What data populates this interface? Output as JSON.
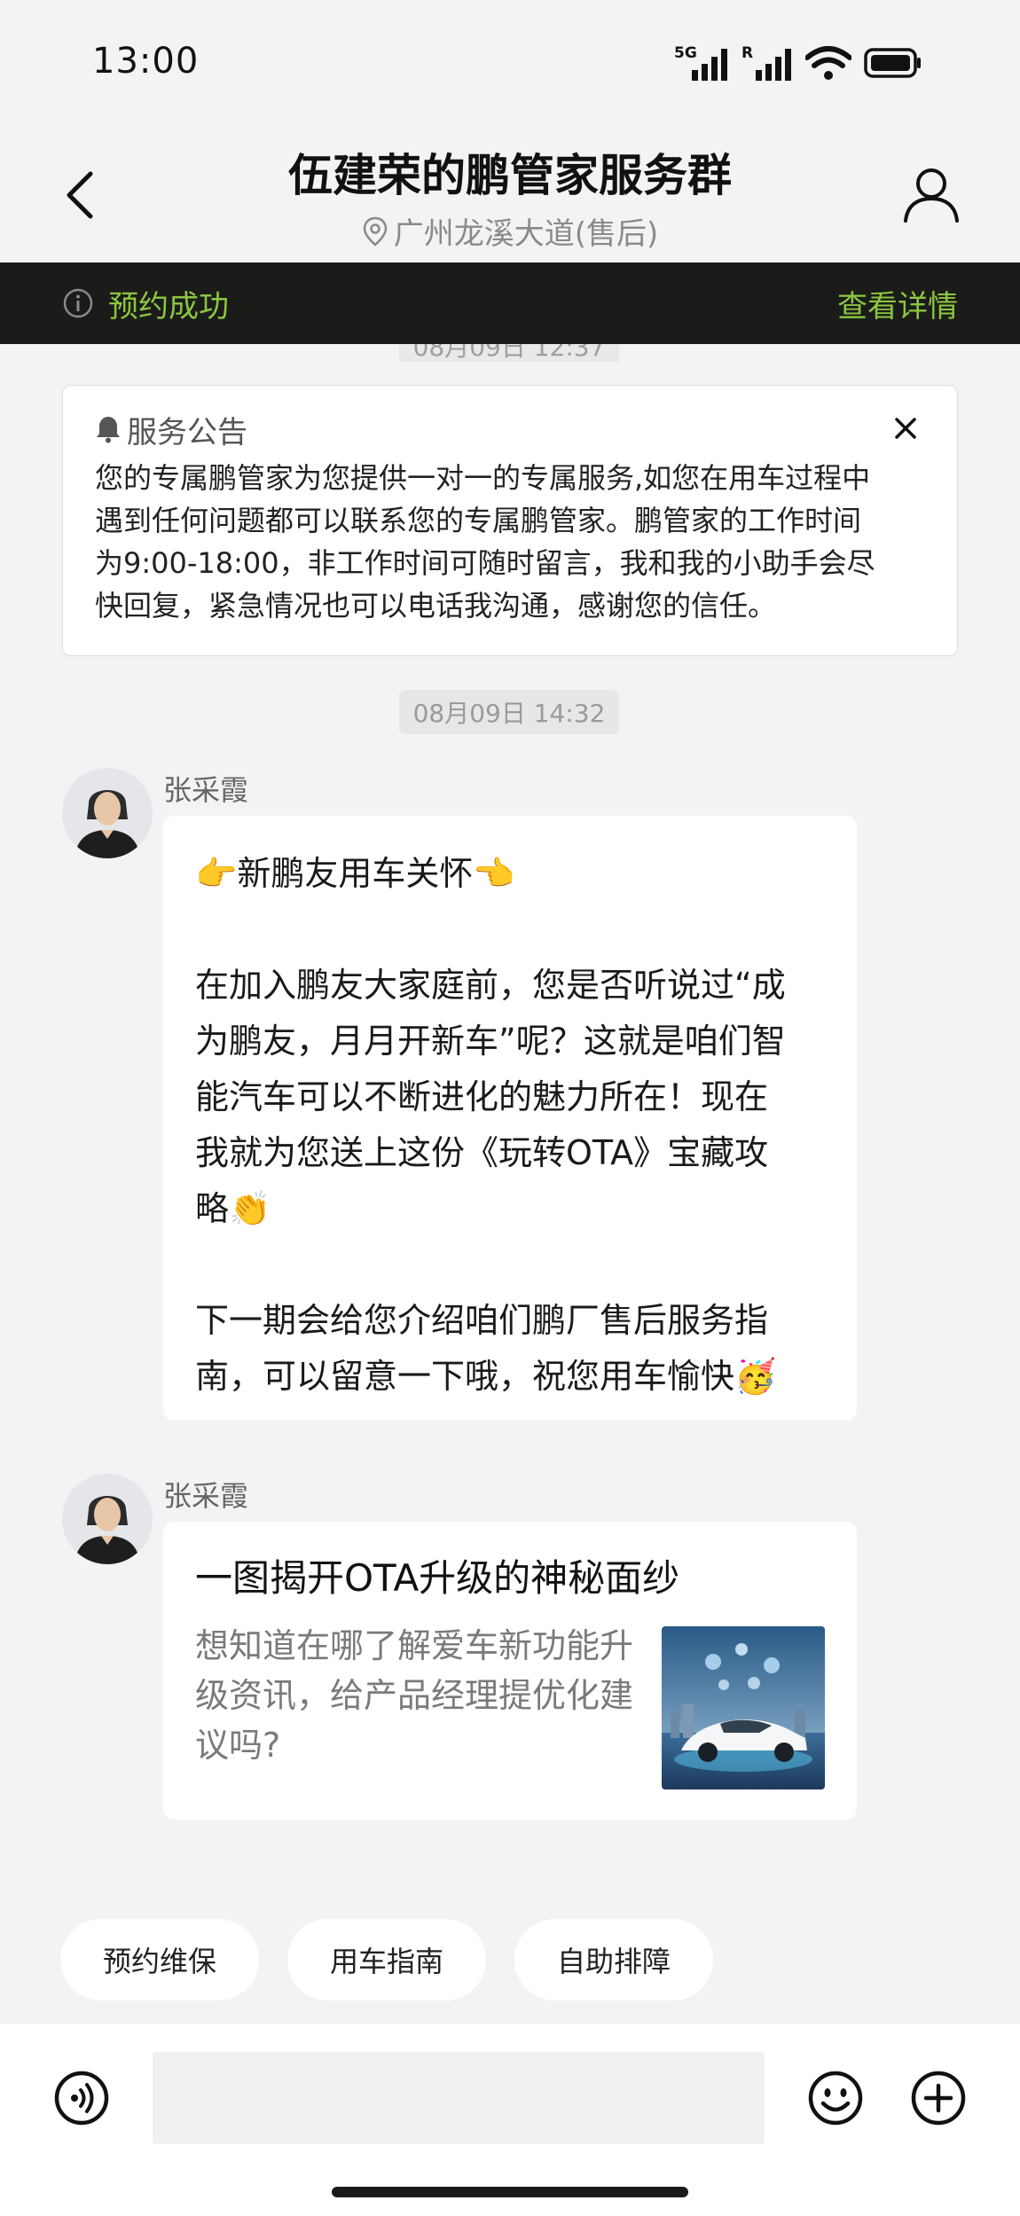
{
  "status_bar": {
    "time": "13:00",
    "signal1_label": "5G",
    "signal2_label": "R"
  },
  "header": {
    "title": "伍建荣的鹏管家服务群",
    "location": "广州龙溪大道(售后)"
  },
  "banner": {
    "status": "预约成功",
    "link": "查看详情"
  },
  "partial_timestamp": "08月09日 12:37",
  "announcement": {
    "title": "服务公告",
    "lines": [
      "您的专属鹏管家为您提供一对一的专属服务,如您在用车过程中",
      "遇到任何问题都可以联系您的专属鹏管家。鹏管家的工作时间",
      "为9:00-18:00，非工作时间可随时留言，我和我的小助手会尽",
      "快回复，紧急情况也可以电话我沟通，感谢您的信任。"
    ]
  },
  "timestamp": "08月09日 14:32",
  "messages": [
    {
      "sender": "张采霞",
      "lines": [
        "👉新鹏友用车关怀👈",
        "",
        "在加入鹏友大家庭前，您是否听说过“成",
        "为鹏友，月月开新车”呢？这就是咱们智",
        "能汽车可以不断进化的魅力所在！现在",
        "我就为您送上这份《玩转OTA》宝藏攻",
        "略👏",
        "",
        "下一期会给您介绍咱们鹏厂售后服务指",
        "南，可以留意一下哦，祝您用车愉快🥳"
      ]
    },
    {
      "sender": "张采霞",
      "card": {
        "title": "一图揭开OTA升级的神秘面纱",
        "description": "想知道在哪了解爱车新功能升级资讯，给产品经理提优化建议吗?"
      }
    }
  ],
  "quick_actions": [
    "预约维保",
    "用车指南",
    "自助排障"
  ],
  "input": {
    "placeholder": ""
  },
  "colors": {
    "accent_green": "#8cc63f",
    "banner_bg": "#1b1c1a",
    "page_bg": "#f2f3f5"
  }
}
